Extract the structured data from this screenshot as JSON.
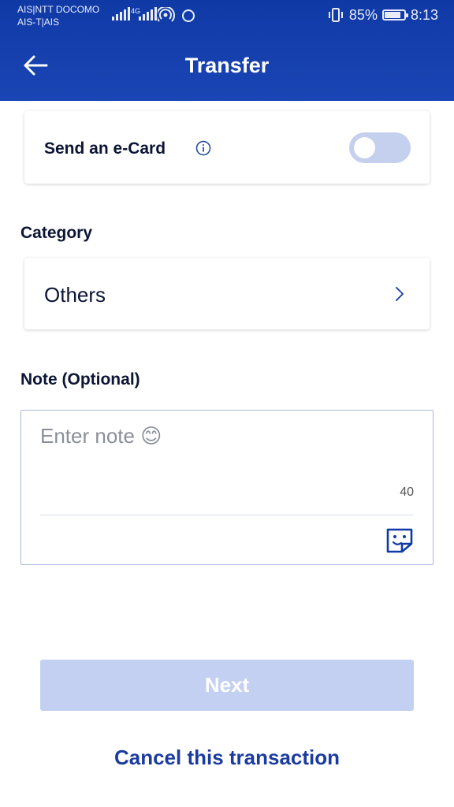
{
  "status_bar": {
    "carrier_line1": "AIS|NTT DOCOMO",
    "carrier_line2": "AIS-T|AIS",
    "network_tag": "4G",
    "battery_percent": "85%",
    "time": "8:13",
    "battery_level": 0.85
  },
  "header": {
    "title": "Transfer",
    "back_icon": "arrow-left-icon"
  },
  "ecard": {
    "label": "Send an e-Card",
    "info_icon": "info-icon",
    "toggle_on": false
  },
  "category": {
    "label": "Category",
    "value": "Others"
  },
  "note": {
    "label": "Note (Optional)",
    "placeholder": "Enter note 😊",
    "remaining_chars": "40",
    "sticker_icon": "sticker-icon"
  },
  "actions": {
    "next_label": "Next",
    "cancel_label": "Cancel this transaction"
  },
  "colors": {
    "header_bg": "#1a45b4",
    "next_disabled_bg": "#c4d0f2",
    "cancel_text": "#1b3c9e",
    "toggle_off": "#c5d0ee"
  }
}
